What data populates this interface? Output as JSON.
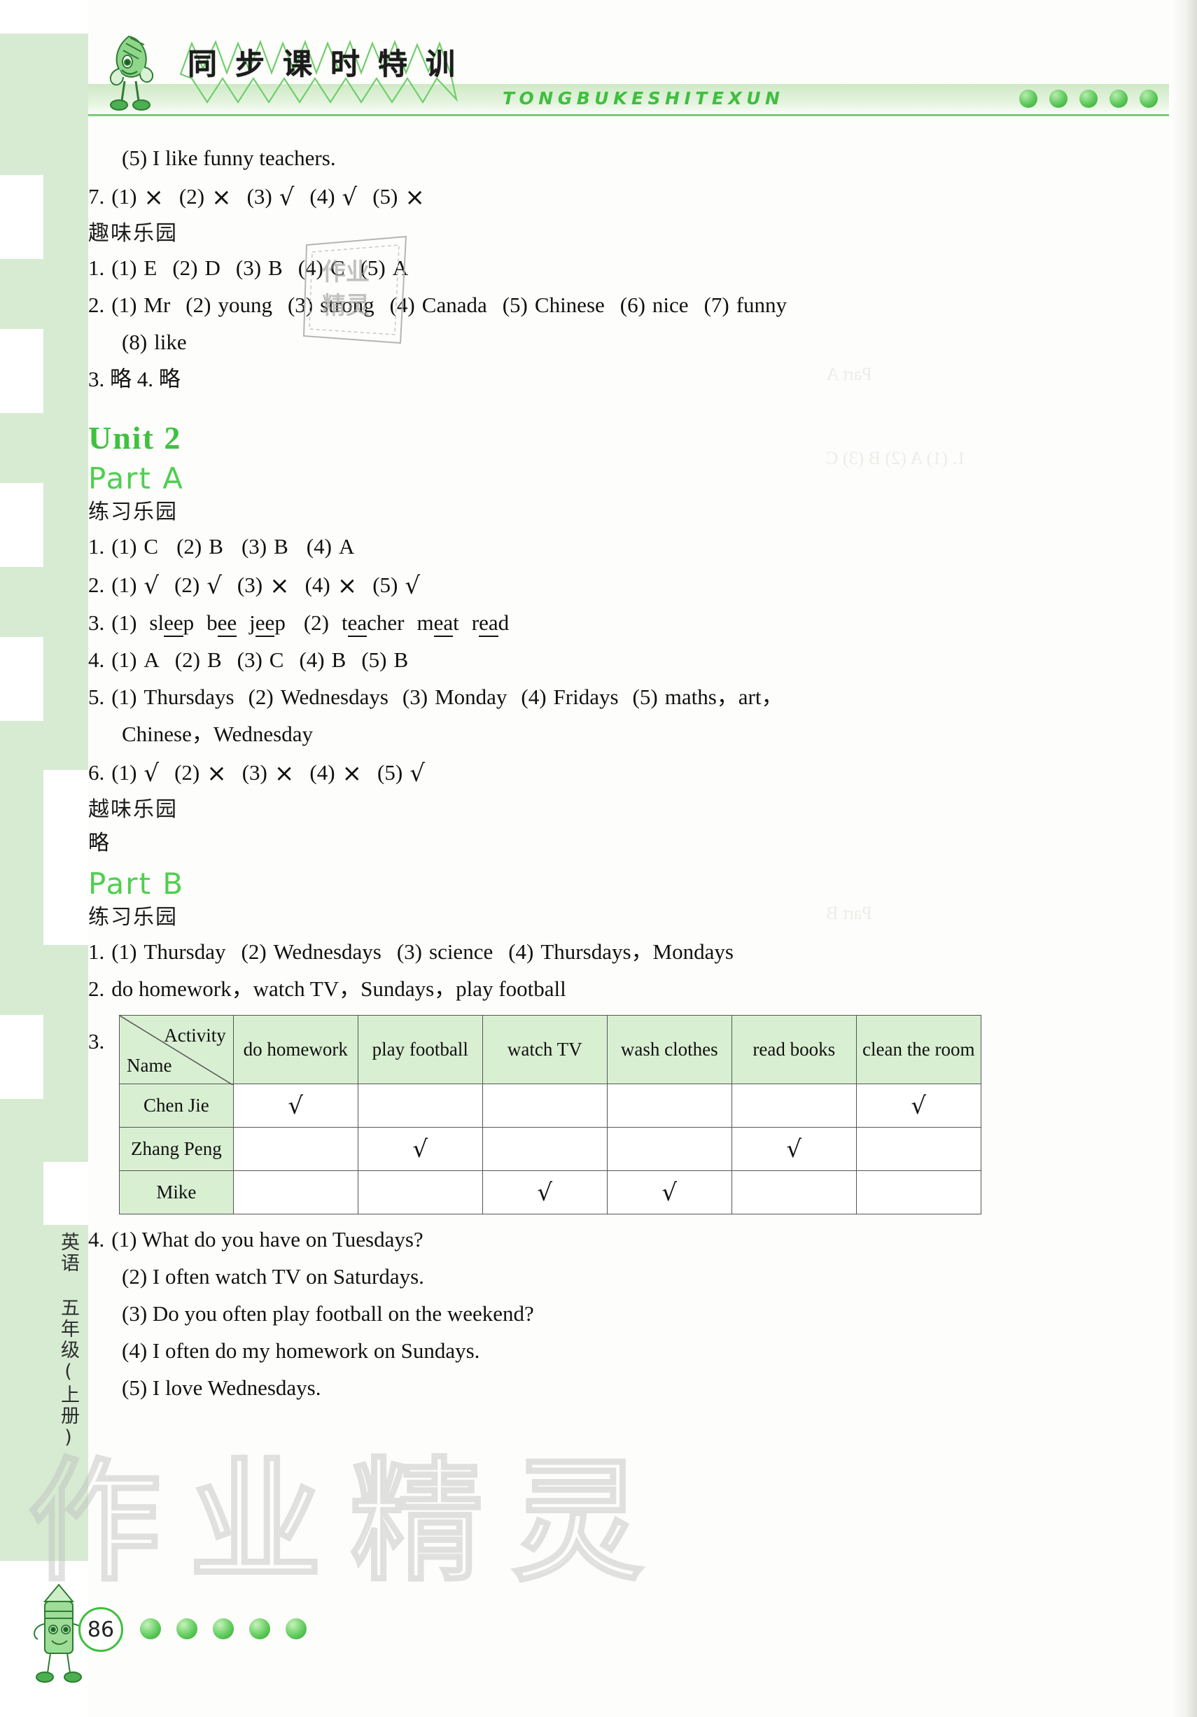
{
  "header": {
    "title_cn": "同步课时特训",
    "title_pinyin": "TONGBUKESHITEXUN",
    "dot_count": 5,
    "accent_color": "#3fbf3f",
    "band_color": "#d6ebd2"
  },
  "sidebar": {
    "label": "英语 五年级(上册)"
  },
  "watermarks": {
    "big": "作业精灵",
    "tag": "作业精灵"
  },
  "content": {
    "prev_unit": {
      "item5": "(5) I like funny teachers.",
      "item7": {
        "num": "7.",
        "answers": [
          {
            "n": "(1)",
            "v": "×"
          },
          {
            "n": "(2)",
            "v": "×"
          },
          {
            "n": "(3)",
            "v": "√"
          },
          {
            "n": "(4)",
            "v": "√"
          },
          {
            "n": "(5)",
            "v": "×"
          }
        ]
      },
      "section_title": "趣味乐园",
      "item1": {
        "num": "1.",
        "answers": [
          {
            "n": "(1)",
            "v": "E"
          },
          {
            "n": "(2)",
            "v": "D"
          },
          {
            "n": "(3)",
            "v": "B"
          },
          {
            "n": "(4)",
            "v": "C"
          },
          {
            "n": "(5)",
            "v": "A"
          }
        ]
      },
      "item2": {
        "num": "2.",
        "answers": [
          {
            "n": "(1)",
            "v": "Mr"
          },
          {
            "n": "(2)",
            "v": "young"
          },
          {
            "n": "(3)",
            "v": "strong"
          },
          {
            "n": "(4)",
            "v": "Canada"
          },
          {
            "n": "(5)",
            "v": "Chinese"
          },
          {
            "n": "(6)",
            "v": "nice"
          },
          {
            "n": "(7)",
            "v": "funny"
          },
          {
            "n": "(8)",
            "v": "like"
          }
        ]
      },
      "item34": "3. 略  4. 略"
    },
    "unit": {
      "title": "Unit 2",
      "part_a": {
        "title": "Part A",
        "lianxi_title": "练习乐园",
        "item1": {
          "num": "1.",
          "answers": [
            {
              "n": "(1)",
              "v": "C"
            },
            {
              "n": "(2)",
              "v": "B"
            },
            {
              "n": "(3)",
              "v": "B"
            },
            {
              "n": "(4)",
              "v": "A"
            }
          ]
        },
        "item2": {
          "num": "2.",
          "answers": [
            {
              "n": "(1)",
              "v": "√"
            },
            {
              "n": "(2)",
              "v": "√"
            },
            {
              "n": "(3)",
              "v": "×"
            },
            {
              "n": "(4)",
              "v": "×"
            },
            {
              "n": "(5)",
              "v": "√"
            }
          ]
        },
        "item3": {
          "num": "3.",
          "groups": [
            {
              "n": "(1)",
              "words": [
                {
                  "pre": "sl",
                  "mid": "ee",
                  "post": "p"
                },
                {
                  "pre": "b",
                  "mid": "ee",
                  "post": ""
                },
                {
                  "pre": "j",
                  "mid": "ee",
                  "post": "p"
                }
              ]
            },
            {
              "n": "(2)",
              "words": [
                {
                  "pre": "t",
                  "mid": "ea",
                  "post": "cher"
                },
                {
                  "pre": "m",
                  "mid": "ea",
                  "post": "t"
                },
                {
                  "pre": "r",
                  "mid": "ea",
                  "post": "d"
                }
              ]
            }
          ]
        },
        "item4": {
          "num": "4.",
          "answers": [
            {
              "n": "(1)",
              "v": "A"
            },
            {
              "n": "(2)",
              "v": "B"
            },
            {
              "n": "(3)",
              "v": "C"
            },
            {
              "n": "(4)",
              "v": "B"
            },
            {
              "n": "(5)",
              "v": "B"
            }
          ]
        },
        "item5": {
          "num": "5.",
          "answers": [
            {
              "n": "(1)",
              "v": "Thursdays"
            },
            {
              "n": "(2)",
              "v": "Wednesdays"
            },
            {
              "n": "(3)",
              "v": "Monday"
            },
            {
              "n": "(4)",
              "v": "Fridays"
            },
            {
              "n": "(5)",
              "v": "maths，art，"
            }
          ],
          "cont": "Chinese，Wednesday"
        },
        "item6": {
          "num": "6.",
          "answers": [
            {
              "n": "(1)",
              "v": "√"
            },
            {
              "n": "(2)",
              "v": "×"
            },
            {
              "n": "(3)",
              "v": "×"
            },
            {
              "n": "(4)",
              "v": "×"
            },
            {
              "n": "(5)",
              "v": "√"
            }
          ]
        },
        "quwei_title": "越味乐园",
        "quwei_body": "略"
      },
      "part_b": {
        "title": "Part B",
        "lianxi_title": "练习乐园",
        "item1": {
          "num": "1.",
          "answers": [
            {
              "n": "(1)",
              "v": "Thursday"
            },
            {
              "n": "(2)",
              "v": "Wednesdays"
            },
            {
              "n": "(3)",
              "v": "science"
            },
            {
              "n": "(4)",
              "v": "Thursdays，Mondays"
            }
          ]
        },
        "item2": {
          "num": "2.",
          "text": "do homework，watch TV，Sundays，play football"
        },
        "item3": {
          "num": "3.",
          "table": {
            "corner_top": "Activity",
            "corner_bottom": "Name",
            "columns": [
              "do homework",
              "play football",
              "watch TV",
              "wash clothes",
              "read books",
              "clean the room"
            ],
            "tick": "√",
            "rows": [
              {
                "name": "Chen Jie",
                "marks": [
                  true,
                  false,
                  false,
                  false,
                  false,
                  true
                ]
              },
              {
                "name": "Zhang Peng",
                "marks": [
                  false,
                  true,
                  false,
                  false,
                  true,
                  false
                ]
              },
              {
                "name": "Mike",
                "marks": [
                  false,
                  false,
                  true,
                  true,
                  false,
                  false
                ]
              }
            ]
          }
        },
        "item4": {
          "num": "4.",
          "lines": [
            "(1) What do you have on Tuesdays?",
            "(2) I often watch TV on Saturdays.",
            "(3) Do you often play football on the weekend?",
            "(4) I often do my homework on Sundays.",
            "(5) I love Wednesdays."
          ]
        }
      }
    }
  },
  "footer": {
    "page_number": "86",
    "dot_count": 5
  }
}
